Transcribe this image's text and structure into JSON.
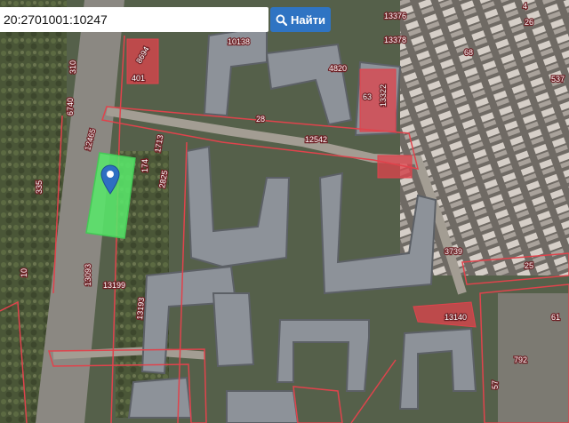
{
  "search": {
    "value": "20:2701001:10247",
    "button_label": "Найти",
    "icon": "search-icon"
  },
  "map": {
    "highlight_color": "#59e66a",
    "parcel_color": "#e0434c",
    "marker_icon": "map-pin-icon",
    "labels": {
      "l1": "13376",
      "l2": "13378",
      "l3": "10138",
      "l4": "4820",
      "l5": "63",
      "l6": "13322",
      "l7": "8694",
      "l8": "401",
      "l9": "310",
      "l10": "6740",
      "l11": "12465",
      "l12": "28",
      "l13": "12542",
      "l14": "1713",
      "l15": "174",
      "l16": "335",
      "l17": "2825",
      "l18": "3739",
      "l19": "25",
      "l20": "13140",
      "l21": "13199",
      "l22": "13193",
      "l23": "13093",
      "l24": "10",
      "l25": "792",
      "l26": "57",
      "l27": "537",
      "l28": "68",
      "l29": "4",
      "l30": "61",
      "l31": "26"
    }
  }
}
